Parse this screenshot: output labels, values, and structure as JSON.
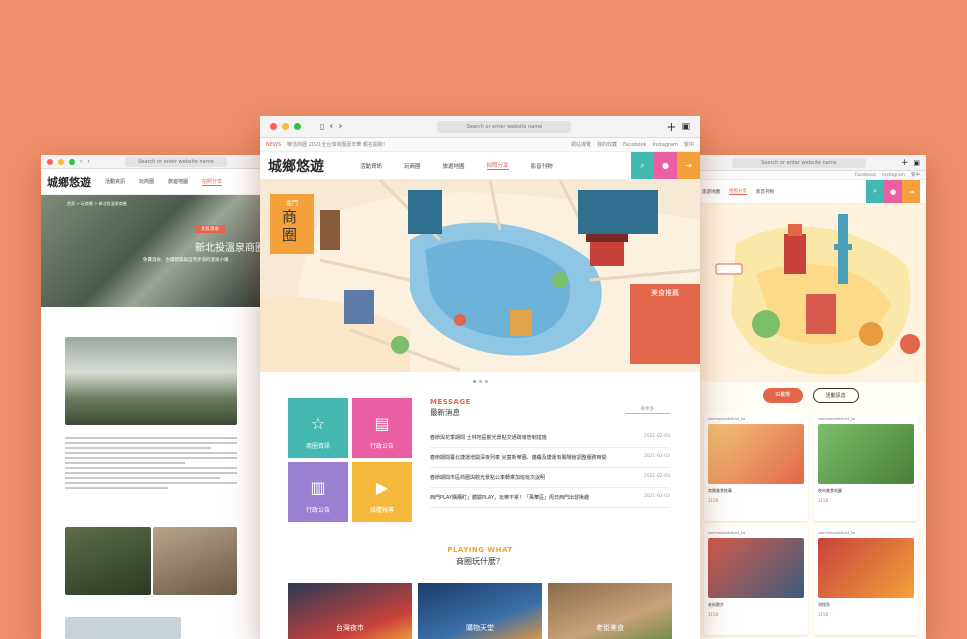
{
  "colors": {
    "background": "#f0906b",
    "accent": "#e2664a",
    "teal": "#43b8b0",
    "pink": "#ea5fa2",
    "orange": "#f4a13b"
  },
  "left": {
    "address": "Search or enter website name",
    "nav": [
      "活動資訊",
      "玩商圈",
      "旅遊地圖",
      "拍照分享"
    ],
    "crumb": "首頁 > 玩商圈 > 新北投溫泉商圈",
    "tag": "北投溫泉",
    "title": "新北投溫泉商圈",
    "subtitle": "免費溫泉、古蹟建築與自然步道的溫泉小鎮"
  },
  "center": {
    "address": "Search or enter website name",
    "ticker_tag": "NEWS",
    "ticker": "樂活商圈 2021全台灣商圈嘉年華 報名開跑！",
    "ticker_links": [
      "網站導覽",
      "我的收藏",
      "Facebook",
      "Instagram",
      "繁中"
    ],
    "logo": "城鄉悠遊",
    "nav": [
      "活動資訊",
      "玩商圈",
      "旅遊地圖",
      "拍照分享",
      "影音刊物"
    ],
    "map_badge": "商圈",
    "map_badge_top": "金門",
    "food_title": "美食推薦",
    "tiles": [
      {
        "label": "商圈資訊",
        "icon": "☆"
      },
      {
        "label": "行政公告",
        "icon": "▤"
      },
      {
        "label": "行政公告",
        "icon": "▥"
      },
      {
        "label": "媒體報導",
        "icon": "▶"
      }
    ],
    "message": {
      "en": "MESSAGE",
      "zh": "最新消息",
      "more": "看更多",
      "items": [
        {
          "title": "春節與花季期間 士林地區觀光景點交通疏導管制措施",
          "date": "2021-02-03"
        },
        {
          "title": "春節期間臺北捷運增開深夜列車 兒童新樂園、貓纜及捷運有關場館調整服務時間",
          "date": "2021-02-03"
        },
        {
          "title": "春節期間市區商圈與觀光景點公車轉乘加班班次說明",
          "date": "2021-02-03"
        },
        {
          "title": "西門PLAY購購盯」體驗PLAY，玩樂不累！「萬華區」周日西門出發揪趣",
          "date": "2021-02-03"
        }
      ]
    },
    "playing": {
      "en": "PLAYING WHAT",
      "zh": "商圈玩什麼？"
    },
    "photos": [
      "台灣夜市",
      "購物天堂",
      "老街美食"
    ]
  },
  "right": {
    "address": "Search or enter website name",
    "nav": [
      "旅遊地圖",
      "拍照分享",
      "影音刊物"
    ],
    "nav_links": [
      "Facebook",
      "Instagram",
      "繁中"
    ],
    "tabs": [
      "IG動態",
      "活動訊息"
    ],
    "cards": [
      {
        "user": "commerciallistrict_tw",
        "caption": "商圈美食推薦",
        "likes": "3150"
      },
      {
        "user": "commerciallistrict_tw",
        "caption": "夜市美食地圖",
        "likes": "3150"
      },
      {
        "user": "commerciallistrict_tw",
        "caption": "老街散步",
        "likes": "3150"
      },
      {
        "user": "commerciallistrict_tw",
        "caption": "灣搜季",
        "likes": "3150"
      }
    ]
  }
}
